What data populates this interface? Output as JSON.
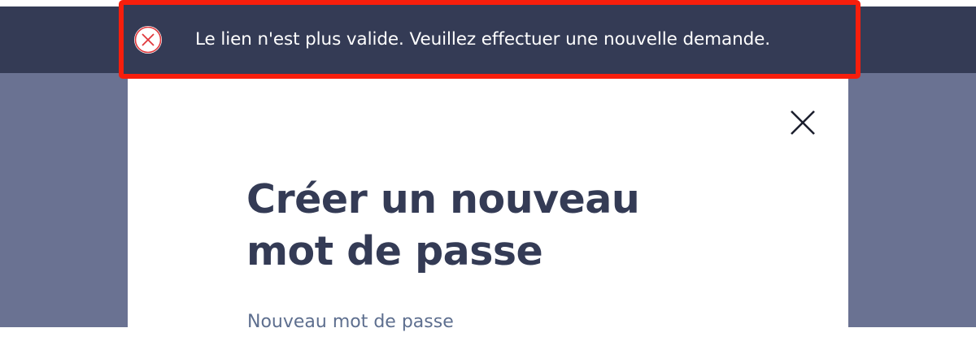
{
  "alert": {
    "icon": "error-circle-icon",
    "message": "Le lien n'est plus valide. Veuillez effectuer une nouvelle demande.",
    "colors": {
      "border": "#f71e0c",
      "background": "#343b55",
      "icon": "#e0383c"
    }
  },
  "modal": {
    "title": "Créer un nouveau mot de passe",
    "close_icon": "close-icon",
    "field_label": "Nouveau mot de passe"
  },
  "colors": {
    "header": "#343b55",
    "overlay": "#6a7292",
    "title": "#343b55",
    "label": "#5e6f8f"
  }
}
